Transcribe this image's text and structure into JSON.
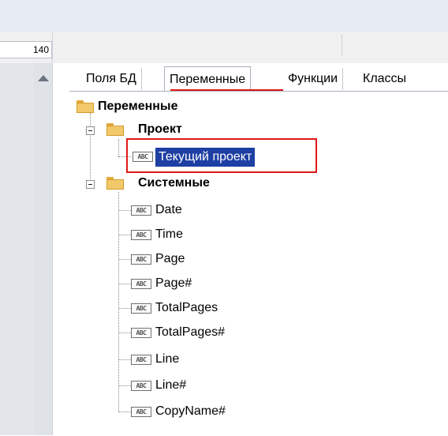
{
  "toolbar": {
    "left_field_value": "140"
  },
  "tabs": [
    {
      "label": "Поля БД",
      "active": false
    },
    {
      "label": "Переменные",
      "active": true
    },
    {
      "label": "Функции",
      "active": false
    },
    {
      "label": "Классы",
      "active": false
    }
  ],
  "tree": {
    "root": {
      "label": "Переменные",
      "icon": "folder-icon"
    },
    "project": {
      "label": "Проект",
      "icon": "folder-icon",
      "items": [
        {
          "label": "Текущий проект",
          "icon": "abc-variable-icon",
          "selected": true
        }
      ]
    },
    "system": {
      "label": "Системные",
      "icon": "folder-icon",
      "items": [
        {
          "label": "Date"
        },
        {
          "label": "Time"
        },
        {
          "label": "Page"
        },
        {
          "label": "Page#"
        },
        {
          "label": "TotalPages"
        },
        {
          "label": "TotalPages#"
        },
        {
          "label": "Line"
        },
        {
          "label": "Line#"
        },
        {
          "label": "CopyName#"
        }
      ]
    },
    "variable_icon_text": "ABC"
  },
  "colors": {
    "selection_bg": "#1e3fa3",
    "highlight_red": "#e01818",
    "folder": "#f2c96a"
  }
}
